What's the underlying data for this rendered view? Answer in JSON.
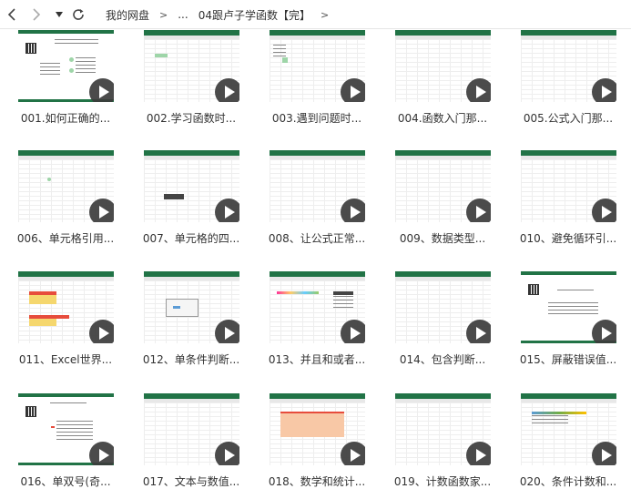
{
  "toolbar": {
    "back_icon": "chevron-left-icon",
    "forward_icon": "chevron-right-icon",
    "dropdown_icon": "caret-down-icon",
    "refresh_icon": "refresh-icon",
    "breadcrumb": [
      "我的网盘",
      "...",
      "04跟卢子学函数【完】"
    ],
    "separator": ">"
  },
  "files": [
    {
      "label": "001.如何正确的...",
      "thumb": "slide"
    },
    {
      "label": "002.学习函数时...",
      "thumb": "sheet-green"
    },
    {
      "label": "003.遇到问题时...",
      "thumb": "sheet-dialog"
    },
    {
      "label": "004.函数入门那...",
      "thumb": "sheet"
    },
    {
      "label": "005.公式入门那...",
      "thumb": "sheet"
    },
    {
      "label": "006、单元格引用...",
      "thumb": "sheet-dot"
    },
    {
      "label": "007、单元格的四...",
      "thumb": "sheet-tooltip"
    },
    {
      "label": "008、让公式正常...",
      "thumb": "sheet"
    },
    {
      "label": "009、数据类型...",
      "thumb": "sheet"
    },
    {
      "label": "010、避免循环引...",
      "thumb": "sheet"
    },
    {
      "label": "011、Excel世界...",
      "thumb": "sheet-colored"
    },
    {
      "label": "012、单条件判断...",
      "thumb": "sheet-dialog2"
    },
    {
      "label": "013、并且和或者...",
      "thumb": "sheet-table"
    },
    {
      "label": "014、包含判断...",
      "thumb": "sheet"
    },
    {
      "label": "015、屏蔽错误值...",
      "thumb": "slide-text"
    },
    {
      "label": "016、单双号(奇...",
      "thumb": "slide-list"
    },
    {
      "label": "017、文本与数值...",
      "thumb": "sheet"
    },
    {
      "label": "018、数学和统计...",
      "thumb": "sheet-orange"
    },
    {
      "label": "019、计数函数家...",
      "thumb": "sheet"
    },
    {
      "label": "020、条件计数和...",
      "thumb": "sheet-blue"
    }
  ],
  "colors": {
    "excel_green": "#217346",
    "play_bg": "#3c3c3c"
  }
}
